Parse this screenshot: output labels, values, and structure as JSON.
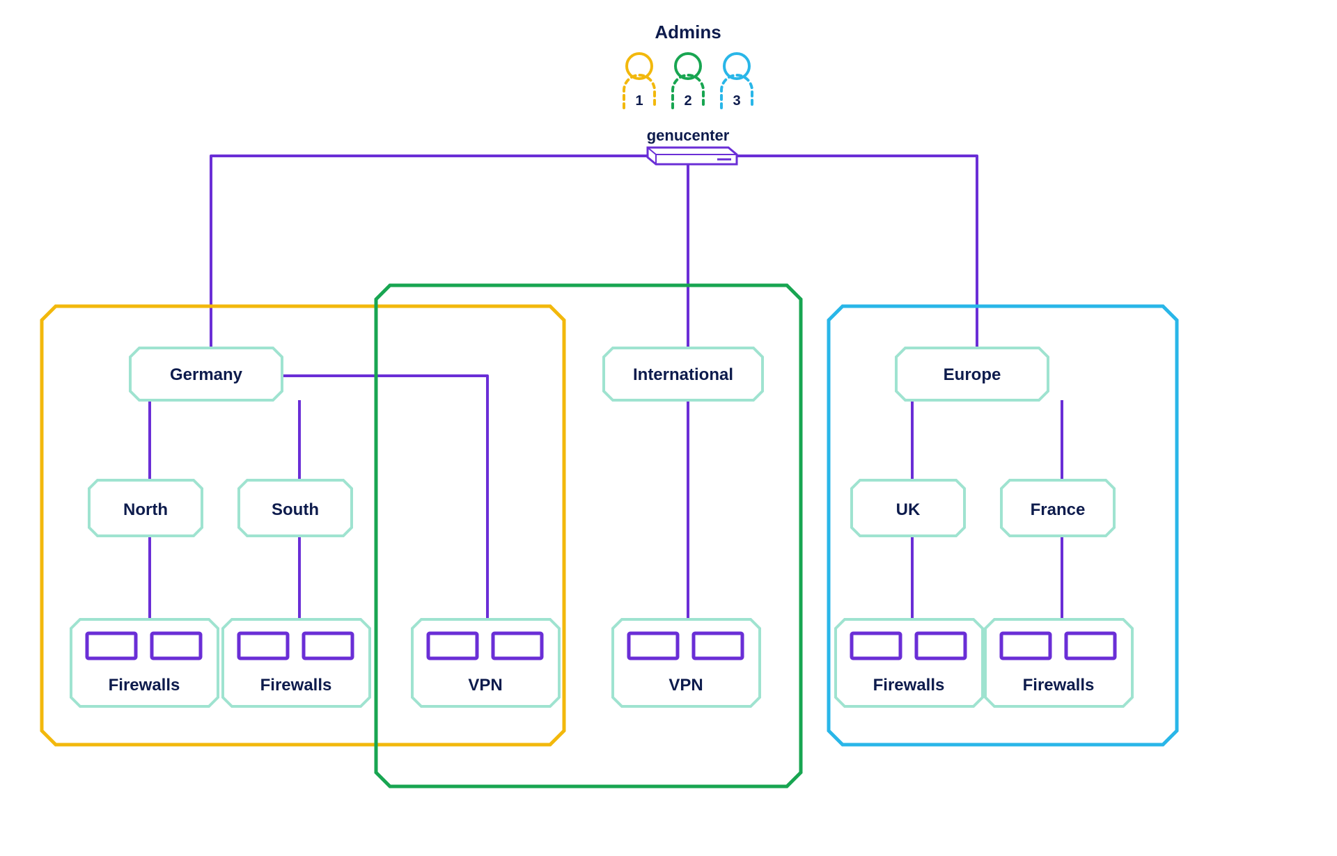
{
  "title": "Admins",
  "device_label": "genucenter",
  "admins": [
    {
      "num": "1",
      "color": "#f2b80c"
    },
    {
      "num": "2",
      "color": "#18a551"
    },
    {
      "num": "3",
      "color": "#29b6e8"
    }
  ],
  "colors": {
    "purple": "#6a2ed6",
    "mint": "#9fe3d0",
    "yellow": "#f2b80c",
    "green": "#18a551",
    "cyan": "#29b6e8",
    "navy": "#0d1b4c"
  },
  "regions": {
    "germany": {
      "label": "Germany",
      "children": [
        {
          "label": "North",
          "leaf": "Firewalls"
        },
        {
          "label": "South",
          "leaf": "Firewalls"
        }
      ]
    },
    "international": {
      "label": "International",
      "vpn1": "VPN",
      "vpn2": "VPN"
    },
    "europe": {
      "label": "Europe",
      "children": [
        {
          "label": "UK",
          "leaf": "Firewalls"
        },
        {
          "label": "France",
          "leaf": "Firewalls"
        }
      ]
    }
  }
}
